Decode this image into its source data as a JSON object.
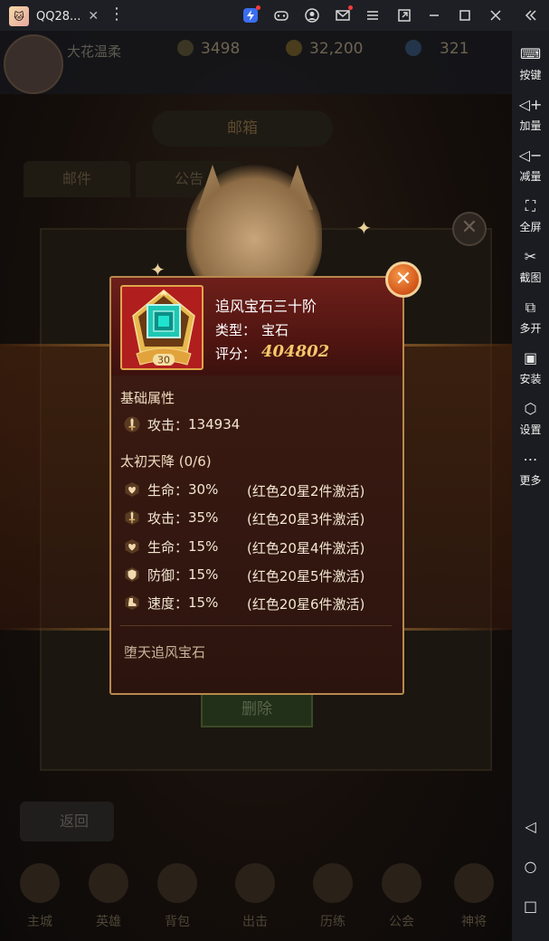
{
  "window": {
    "tab_title": "QQ28...",
    "tab_close": "✕",
    "kebab": "⋮",
    "toolbar_icons": [
      "lightning-icon",
      "gamepad-icon",
      "account-icon",
      "mail-icon",
      "menu-icon",
      "restore-icon",
      "minimize-icon",
      "maximize-icon",
      "close-icon",
      "collapse-icon"
    ]
  },
  "sidebar": {
    "items": [
      {
        "label": "按键",
        "icon": "keyboard-icon",
        "glyph": "⌨"
      },
      {
        "label": "加量",
        "icon": "volume-up-icon",
        "glyph": "◁+"
      },
      {
        "label": "减量",
        "icon": "volume-down-icon",
        "glyph": "◁−"
      },
      {
        "label": "全屏",
        "icon": "fullscreen-icon",
        "glyph": "⛶"
      },
      {
        "label": "截图",
        "icon": "scissors-icon",
        "glyph": "✂"
      },
      {
        "label": "多开",
        "icon": "multi-instance-icon",
        "glyph": "⧉"
      },
      {
        "label": "安装",
        "icon": "apk-install-icon",
        "glyph": "▣"
      },
      {
        "label": "设置",
        "icon": "settings-icon",
        "glyph": "⬡"
      },
      {
        "label": "更多",
        "icon": "more-icon",
        "glyph": "⋯"
      }
    ],
    "nav": {
      "back": "◁",
      "home": "○",
      "recent": "□"
    }
  },
  "background": {
    "player_name": "大花温柔",
    "stat_power": "3498",
    "stat_gold": "32,200",
    "stat_gem": "321",
    "mailbox_title": "邮箱",
    "tab_mail": "邮件",
    "tab_notice": "公告",
    "delete_button": "删除",
    "back_button": "返回",
    "nav": [
      "主城",
      "英雄",
      "背包",
      "出击",
      "历练",
      "公会",
      "神将"
    ]
  },
  "popup": {
    "item_name": "追风宝石三十阶",
    "item_level": "30",
    "type_label": "类型：",
    "type_value": "宝石",
    "score_label": "评分：",
    "score_value": "404802",
    "base_section_title": "基础属性",
    "base_attr": {
      "label": "攻击：",
      "value": "134934",
      "icon": "sword-icon"
    },
    "set_section_title": "太初天降 (0/6)",
    "set_bonuses": [
      {
        "label": "生命：",
        "value": "30%",
        "condition": "(红色20星2件激活)",
        "icon": "heart-icon"
      },
      {
        "label": "攻击：",
        "value": "35%",
        "condition": "(红色20星3件激活)",
        "icon": "sword-icon"
      },
      {
        "label": "生命：",
        "value": "15%",
        "condition": "(红色20星4件激活)",
        "icon": "heart-icon"
      },
      {
        "label": "防御：",
        "value": "15%",
        "condition": "(红色20星5件激活)",
        "icon": "shield-icon"
      },
      {
        "label": "速度：",
        "value": "15%",
        "condition": "(红色20星6件激活)",
        "icon": "boot-icon"
      }
    ],
    "footer": "堕天追风宝石",
    "close_glyph": "✕"
  },
  "colors": {
    "popup_border": "#b8894c",
    "score": "#f4c76a",
    "header_red": "#6e1f1a",
    "close_orange": "#d4591c"
  }
}
